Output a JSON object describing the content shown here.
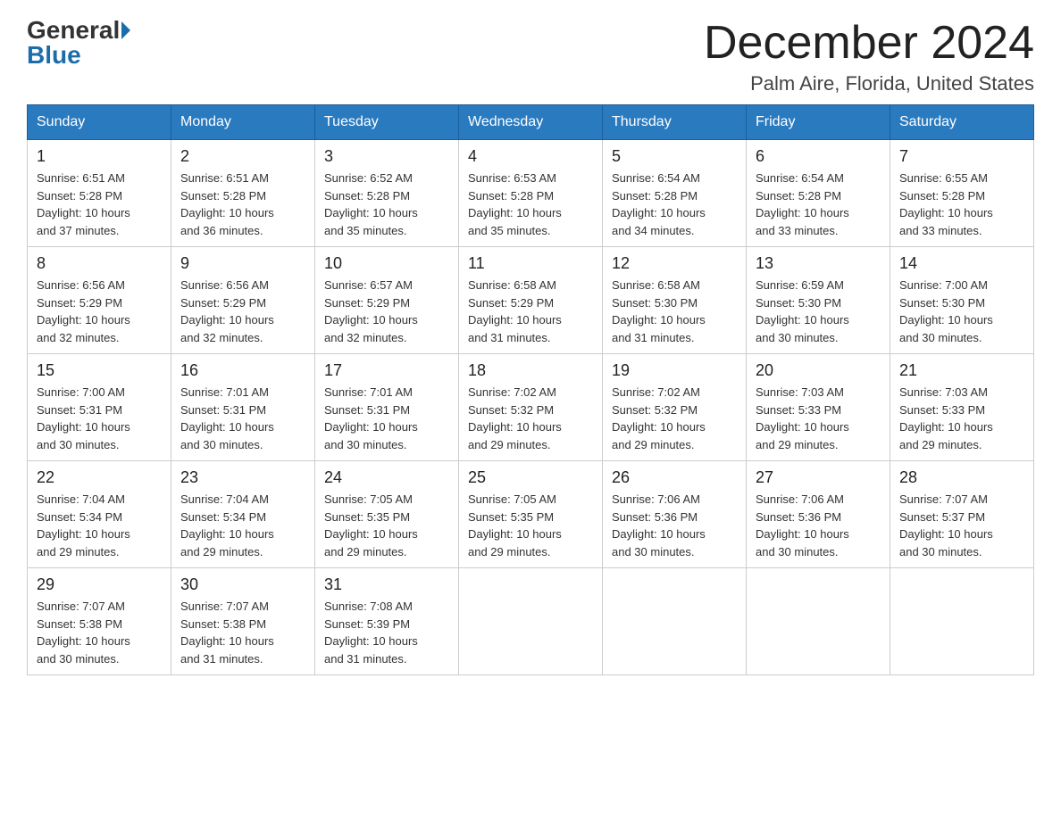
{
  "header": {
    "logo_general": "General",
    "logo_blue": "Blue",
    "month_title": "December 2024",
    "location": "Palm Aire, Florida, United States"
  },
  "weekdays": [
    "Sunday",
    "Monday",
    "Tuesday",
    "Wednesday",
    "Thursday",
    "Friday",
    "Saturday"
  ],
  "weeks": [
    [
      {
        "day": "1",
        "sunrise": "6:51 AM",
        "sunset": "5:28 PM",
        "daylight": "10 hours and 37 minutes."
      },
      {
        "day": "2",
        "sunrise": "6:51 AM",
        "sunset": "5:28 PM",
        "daylight": "10 hours and 36 minutes."
      },
      {
        "day": "3",
        "sunrise": "6:52 AM",
        "sunset": "5:28 PM",
        "daylight": "10 hours and 35 minutes."
      },
      {
        "day": "4",
        "sunrise": "6:53 AM",
        "sunset": "5:28 PM",
        "daylight": "10 hours and 35 minutes."
      },
      {
        "day": "5",
        "sunrise": "6:54 AM",
        "sunset": "5:28 PM",
        "daylight": "10 hours and 34 minutes."
      },
      {
        "day": "6",
        "sunrise": "6:54 AM",
        "sunset": "5:28 PM",
        "daylight": "10 hours and 33 minutes."
      },
      {
        "day": "7",
        "sunrise": "6:55 AM",
        "sunset": "5:28 PM",
        "daylight": "10 hours and 33 minutes."
      }
    ],
    [
      {
        "day": "8",
        "sunrise": "6:56 AM",
        "sunset": "5:29 PM",
        "daylight": "10 hours and 32 minutes."
      },
      {
        "day": "9",
        "sunrise": "6:56 AM",
        "sunset": "5:29 PM",
        "daylight": "10 hours and 32 minutes."
      },
      {
        "day": "10",
        "sunrise": "6:57 AM",
        "sunset": "5:29 PM",
        "daylight": "10 hours and 32 minutes."
      },
      {
        "day": "11",
        "sunrise": "6:58 AM",
        "sunset": "5:29 PM",
        "daylight": "10 hours and 31 minutes."
      },
      {
        "day": "12",
        "sunrise": "6:58 AM",
        "sunset": "5:30 PM",
        "daylight": "10 hours and 31 minutes."
      },
      {
        "day": "13",
        "sunrise": "6:59 AM",
        "sunset": "5:30 PM",
        "daylight": "10 hours and 30 minutes."
      },
      {
        "day": "14",
        "sunrise": "7:00 AM",
        "sunset": "5:30 PM",
        "daylight": "10 hours and 30 minutes."
      }
    ],
    [
      {
        "day": "15",
        "sunrise": "7:00 AM",
        "sunset": "5:31 PM",
        "daylight": "10 hours and 30 minutes."
      },
      {
        "day": "16",
        "sunrise": "7:01 AM",
        "sunset": "5:31 PM",
        "daylight": "10 hours and 30 minutes."
      },
      {
        "day": "17",
        "sunrise": "7:01 AM",
        "sunset": "5:31 PM",
        "daylight": "10 hours and 30 minutes."
      },
      {
        "day": "18",
        "sunrise": "7:02 AM",
        "sunset": "5:32 PM",
        "daylight": "10 hours and 29 minutes."
      },
      {
        "day": "19",
        "sunrise": "7:02 AM",
        "sunset": "5:32 PM",
        "daylight": "10 hours and 29 minutes."
      },
      {
        "day": "20",
        "sunrise": "7:03 AM",
        "sunset": "5:33 PM",
        "daylight": "10 hours and 29 minutes."
      },
      {
        "day": "21",
        "sunrise": "7:03 AM",
        "sunset": "5:33 PM",
        "daylight": "10 hours and 29 minutes."
      }
    ],
    [
      {
        "day": "22",
        "sunrise": "7:04 AM",
        "sunset": "5:34 PM",
        "daylight": "10 hours and 29 minutes."
      },
      {
        "day": "23",
        "sunrise": "7:04 AM",
        "sunset": "5:34 PM",
        "daylight": "10 hours and 29 minutes."
      },
      {
        "day": "24",
        "sunrise": "7:05 AM",
        "sunset": "5:35 PM",
        "daylight": "10 hours and 29 minutes."
      },
      {
        "day": "25",
        "sunrise": "7:05 AM",
        "sunset": "5:35 PM",
        "daylight": "10 hours and 29 minutes."
      },
      {
        "day": "26",
        "sunrise": "7:06 AM",
        "sunset": "5:36 PM",
        "daylight": "10 hours and 30 minutes."
      },
      {
        "day": "27",
        "sunrise": "7:06 AM",
        "sunset": "5:36 PM",
        "daylight": "10 hours and 30 minutes."
      },
      {
        "day": "28",
        "sunrise": "7:07 AM",
        "sunset": "5:37 PM",
        "daylight": "10 hours and 30 minutes."
      }
    ],
    [
      {
        "day": "29",
        "sunrise": "7:07 AM",
        "sunset": "5:38 PM",
        "daylight": "10 hours and 30 minutes."
      },
      {
        "day": "30",
        "sunrise": "7:07 AM",
        "sunset": "5:38 PM",
        "daylight": "10 hours and 31 minutes."
      },
      {
        "day": "31",
        "sunrise": "7:08 AM",
        "sunset": "5:39 PM",
        "daylight": "10 hours and 31 minutes."
      },
      null,
      null,
      null,
      null
    ]
  ],
  "labels": {
    "sunrise": "Sunrise:",
    "sunset": "Sunset:",
    "daylight": "Daylight:"
  }
}
